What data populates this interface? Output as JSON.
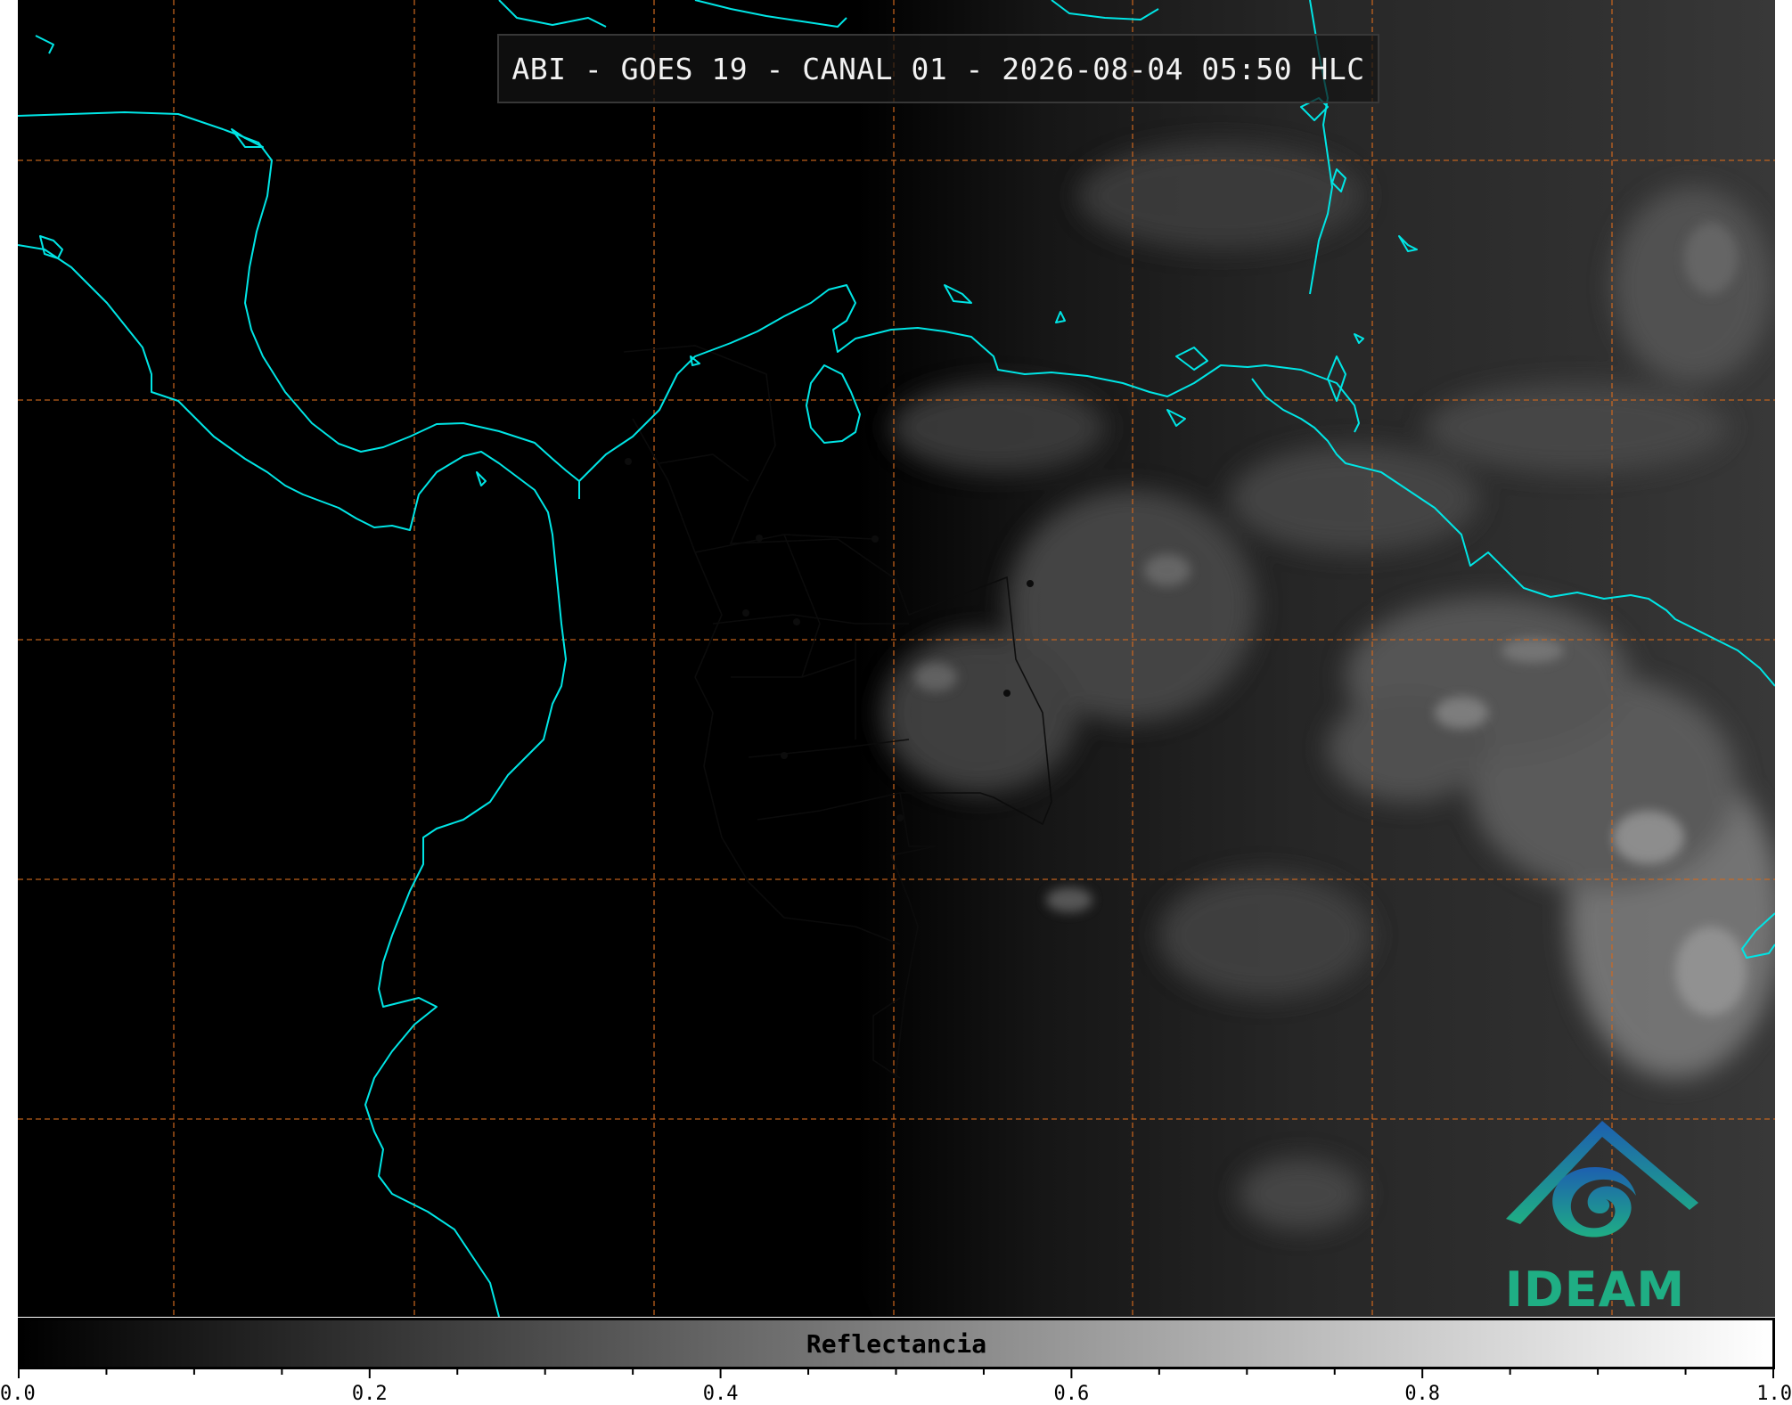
{
  "title": "ABI - GOES 19 - CANAL 01 - 2026-08-04 05:50 HLC",
  "logo": {
    "text": "IDEAM",
    "icon": "ideam-mountain-swirl-logo"
  },
  "colorbar": {
    "label": "Reflectancia",
    "min": 0.0,
    "max": 1.0,
    "major_ticks": [
      "0.0",
      "0.2",
      "0.4",
      "0.6",
      "0.8",
      "1.0"
    ],
    "minor_step": 0.05,
    "colormap": "gray"
  },
  "colors": {
    "coastline": "#00e5e5",
    "gridlines": "#d2691e",
    "borders": "#101010",
    "title_box": "#141414"
  },
  "map": {
    "gridlines": "dashed",
    "features": [
      "coastlines",
      "national-borders",
      "department-borders",
      "cloud-imagery"
    ]
  }
}
